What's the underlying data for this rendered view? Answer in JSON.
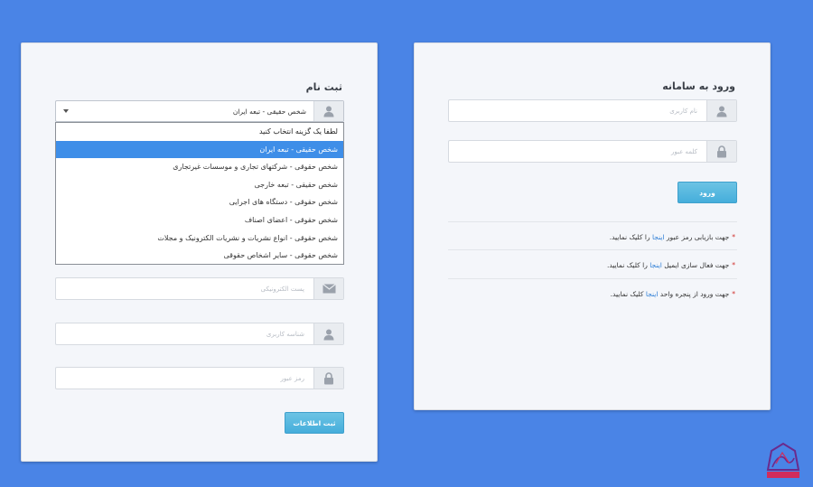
{
  "login": {
    "title": "ورود به سامانه",
    "username_placeholder": "نام کاربری",
    "password_placeholder": "کلمه عبور",
    "submit_label": "ورود",
    "notes": [
      {
        "star": "*",
        "before": "جهت بازیابی رمز عبور",
        "link": "اینجا",
        "after": "را کلیک نمایید."
      },
      {
        "star": "*",
        "before": "جهت فعال سازی ایمیل",
        "link": "اینجا",
        "after": "را کلیک نمایید."
      },
      {
        "star": "*",
        "before": "جهت ورود از پنجره واحد",
        "link": "اینجا",
        "after": "کلیک نمایید."
      }
    ]
  },
  "register": {
    "title": "ثبت نام",
    "person_type_selected": "شخص حقیقی - تبعه ایران",
    "person_type_options": [
      "لطفا یک گزینه انتخاب کنید",
      "شخص حقیقی - تبعه ایران",
      "شخص حقوقی - شرکتهای تجاری و موسسات غیرتجاری",
      "شخص حقیقی - تبعه خارجی",
      "شخص حقوقی - دستگاه های اجرایی",
      "شخص حقوقی - اعضای اصناف",
      "شخص حقوقی - انواع نشریات و نشریات الکترونیک و مجلات",
      "شخص حقوقی - سایر اشخاص حقوقی"
    ],
    "selected_index": 1,
    "email_placeholder": "پست الکترونیکی",
    "userid_placeholder": "شناسه کاربری",
    "password_placeholder": "رمز عبور",
    "submit_label": "ثبت اطلاعات"
  },
  "colors": {
    "background": "#4a84e6",
    "accent_button": "#45aedb",
    "selected_option": "#3e8ee8",
    "link": "#2f7fd6",
    "star": "#d0312d"
  },
  "icons": {
    "user": "user-icon",
    "lock": "lock-icon",
    "mail": "envelope-icon",
    "caret": "caret-down-icon",
    "logo": "site-logo"
  }
}
